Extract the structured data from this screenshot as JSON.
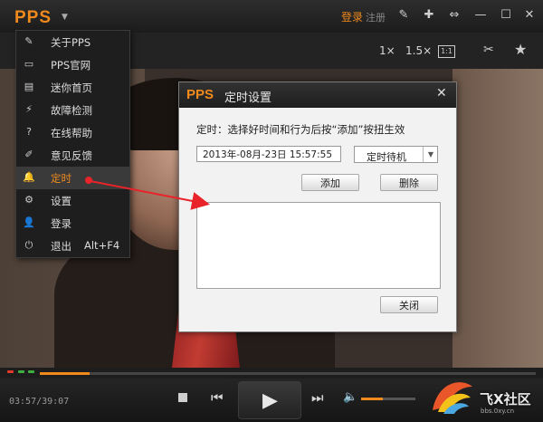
{
  "app": {
    "logo": "PPS",
    "login": "登录",
    "register": "注册"
  },
  "toolbar": {
    "speed_1x": "1×",
    "speed_15x": "1.5×",
    "ratio_label": "1:1"
  },
  "menu": {
    "items": [
      {
        "icon": "tag-icon",
        "label": "关于PPS"
      },
      {
        "icon": "monitor-icon",
        "label": "PPS官网"
      },
      {
        "icon": "window-icon",
        "label": "迷你首页"
      },
      {
        "icon": "wrench-icon",
        "label": "故障检测"
      },
      {
        "icon": "help-icon",
        "label": "在线帮助"
      },
      {
        "icon": "edit-icon",
        "label": "意见反馈"
      },
      {
        "icon": "bell-icon",
        "label": "定时"
      },
      {
        "icon": "gear-icon",
        "label": "设置"
      },
      {
        "icon": "user-icon",
        "label": "登录"
      },
      {
        "icon": "power-icon",
        "label": "退出",
        "shortcut": "Alt+F4"
      }
    ],
    "active_index": 6
  },
  "dialog": {
    "logo": "PPS",
    "title": "定时设置",
    "instruction": "定时：选择好时间和行为后按“添加”按扭生效",
    "datetime": "2013年-08月-23日 15:57:55",
    "action": "定时待机",
    "add_label": "添加",
    "delete_label": "删除",
    "close_label": "关闭"
  },
  "player": {
    "time": "03:57/39:07",
    "progress": 0.1,
    "volume": 0.4
  },
  "watermark": {
    "text": "飞X社区",
    "url": "bbs.0xy.cn"
  },
  "colors": {
    "accent": "#f08a1c",
    "annotation": "#e8232a"
  }
}
